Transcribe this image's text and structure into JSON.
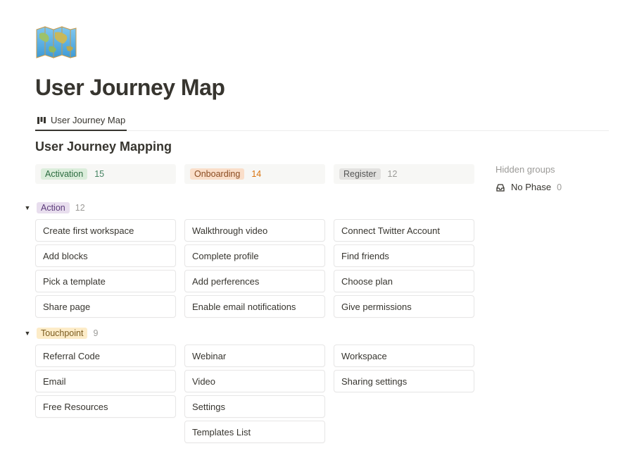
{
  "page": {
    "title": "User Journey Map",
    "tab_label": "User Journey Map",
    "subtitle": "User Journey Mapping"
  },
  "columns": [
    {
      "label": "Activation",
      "count": "15",
      "tagClass": "tag-green",
      "countClass": "count-green"
    },
    {
      "label": "Onboarding",
      "count": "14",
      "tagClass": "tag-orange",
      "countClass": "count-orange"
    },
    {
      "label": "Register",
      "count": "12",
      "tagClass": "tag-gray",
      "countClass": "count-gray"
    }
  ],
  "groups": {
    "action": {
      "label": "Action",
      "count": "12",
      "tagClass": "tag-purple",
      "rows": [
        [
          "Create first workspace",
          "Walkthrough video",
          "Connect Twitter Account"
        ],
        [
          "Add blocks",
          "Complete profile",
          "Find friends"
        ],
        [
          "Pick a template",
          "Add perferences",
          "Choose plan"
        ],
        [
          "Share page",
          "Enable email notifications",
          "Give permissions"
        ]
      ]
    },
    "touchpoint": {
      "label": "Touchpoint",
      "count": "9",
      "tagClass": "tag-yellow",
      "rows": [
        [
          "Referral Code",
          "Webinar",
          "Workspace"
        ],
        [
          "Email",
          "Video",
          "Sharing settings"
        ],
        [
          "Free Resources",
          "Settings",
          ""
        ],
        [
          "",
          "Templates List",
          ""
        ]
      ]
    }
  },
  "hidden": {
    "title": "Hidden groups",
    "item_label": "No Phase",
    "item_count": "0"
  }
}
